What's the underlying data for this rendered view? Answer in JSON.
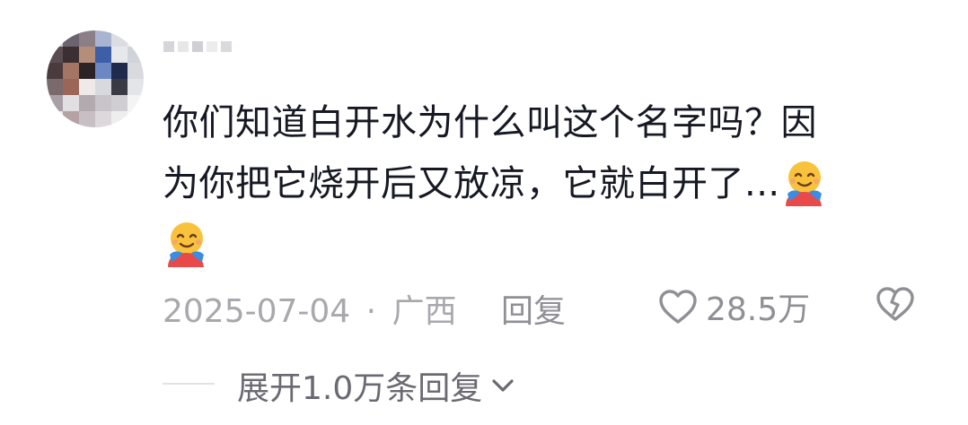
{
  "comment": {
    "username": "",
    "text_line1": "你们知道白开水为什么叫这个名字吗？因",
    "text_line2": "为你把它烧开后又放凉，它就白开了...",
    "emoji": "hugging-face-emoji"
  },
  "meta": {
    "date": "2025-07-04",
    "separator": "·",
    "location": "广西",
    "reply_label": "回复"
  },
  "actions": {
    "like_count": "28.5万",
    "like_icon": "heart-outline-icon",
    "dislike_icon": "broken-heart-icon"
  },
  "replies": {
    "expand_label": "展开1.0万条回复",
    "expand_icon": "chevron-down-icon"
  },
  "colors": {
    "text": "#161823",
    "meta": "#a8a8ad",
    "action": "#8f8f95"
  }
}
